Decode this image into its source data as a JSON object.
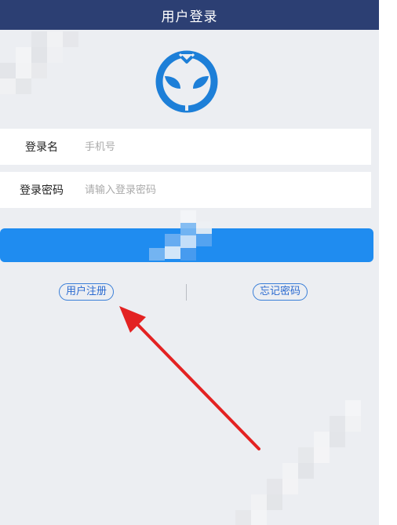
{
  "header": {
    "title": "用户登录"
  },
  "form": {
    "username_label": "登录名",
    "username_placeholder": "手机号",
    "password_label": "登录密码",
    "password_placeholder": "请输入登录密码",
    "login_label": ""
  },
  "links": {
    "register": "用户注册",
    "forgot": "忘记密码"
  },
  "colors": {
    "header": "#2c3f73",
    "primary": "#1f8cf0",
    "link": "#2a6ad0",
    "arrow": "#e32222",
    "background": "#eceef2"
  },
  "icons": {
    "logo": "alien-face-logo-icon",
    "annotation": "red-arrow-icon"
  }
}
